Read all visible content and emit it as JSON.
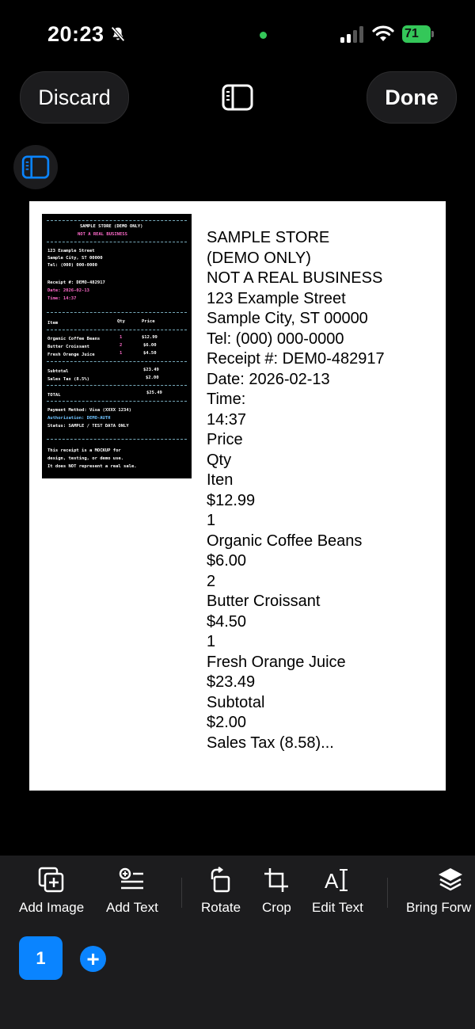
{
  "status_bar": {
    "time": "20:23",
    "battery": "71",
    "icons": [
      "bell-slash-icon",
      "cellular-signal-icon",
      "wifi-icon",
      "battery-charging-icon"
    ],
    "dot_color": "#34c759"
  },
  "header": {
    "discard_label": "Discard",
    "done_label": "Done",
    "sidebar_icon": "sidebar-icon"
  },
  "receipt_image": {
    "store": "SAMPLE STORE (DEMO ONLY)",
    "notice": "NOT A REAL BUSINESS",
    "address1": "123 Example Street",
    "address2": "Sample City, ST 00000",
    "tel": "Tel: (000) 000-0000",
    "receipt_no": "Receipt #: DEMO-482917",
    "date": "Date: 2026-02-13",
    "time": "Time: 14:37",
    "col_item": "Item",
    "col_qty": "Qty",
    "col_price": "Price",
    "items": [
      {
        "name": "Organic Coffee Beans",
        "qty": "1",
        "price": "$12.99"
      },
      {
        "name": "Butter Croissant",
        "qty": "2",
        "price": "$6.00"
      },
      {
        "name": "Fresh Orange Juice",
        "qty": "1",
        "price": "$4.50"
      }
    ],
    "subtotal_label": "Subtotal",
    "subtotal": "$23.49",
    "tax_label": "Sales Tax (8.5%)",
    "tax": "$2.00",
    "total_label": "TOTAL",
    "total": "$25.49",
    "payment": "Payment Method: Visa (XXXX 1234)",
    "authorization": "Authorization: DEMO-AUTH",
    "status": "Status: SAMPLE / TEST DATA ONLY",
    "footer1": "This receipt is a MOCKUP for",
    "footer2": "design, testing, or demo use.",
    "footer3": "It does NOT represent a real sale."
  },
  "ocr_lines": [
    "SAMPLE STORE",
    "(DEMO ONLY)",
    "NOT A REAL BUSINESS",
    "123 Example Street",
    "Sample City, ST 00000",
    "Tel: (000) 000-0000",
    "Receipt #: DEM0-482917",
    "Date: 2026-02-13",
    "Time:",
    "14:37",
    "Price",
    "Qty",
    "Iten",
    "$12.99",
    "1",
    "Organic Coffee Beans",
    "$6.00",
    "2",
    "Butter Croissant",
    "$4.50",
    "1",
    "Fresh Orange Juice",
    "$23.49",
    "Subtotal",
    "$2.00",
    "Sales Tax (8.58)..."
  ],
  "toolbar": {
    "add_image": "Add Image",
    "add_text": "Add Text",
    "rotate": "Rotate",
    "crop": "Crop",
    "edit_text": "Edit Text",
    "bring_forward": "Bring Forw"
  },
  "pages": {
    "current": "1",
    "add": "+"
  },
  "colors": {
    "accent": "#0a84ff",
    "toolbar_bg": "#1c1c1e"
  }
}
